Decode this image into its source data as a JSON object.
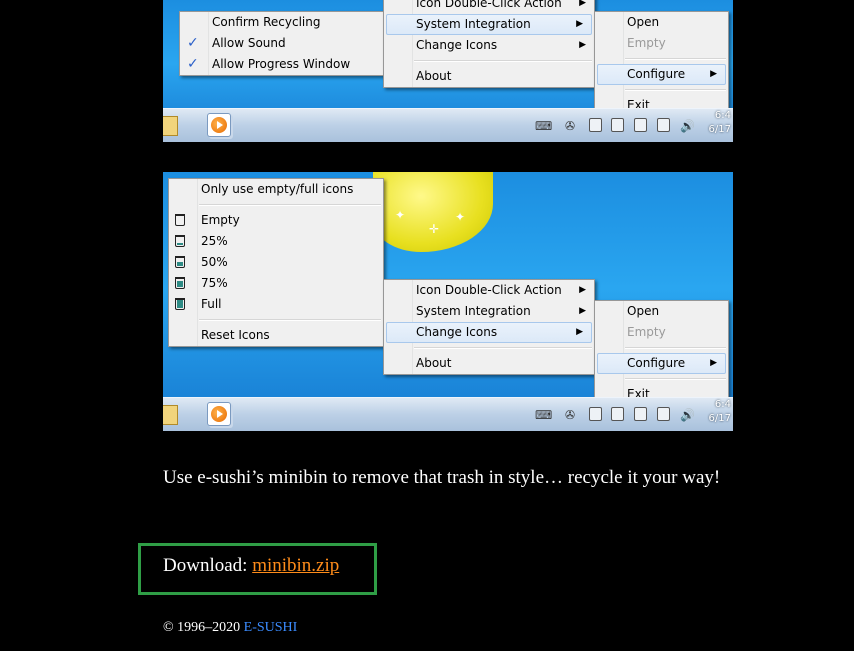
{
  "screenshot1": {
    "left_menu": [
      {
        "label": "Confirm Recycling",
        "checked": false
      },
      {
        "label": "Allow Sound",
        "checked": true
      },
      {
        "label": "Allow Progress Window",
        "checked": true
      }
    ],
    "main_menu": {
      "top_partial": "Icon Double-Click Action",
      "items": [
        "System Integration",
        "Change Icons"
      ],
      "about": "About"
    },
    "right_menu": {
      "open": "Open",
      "empty": "Empty",
      "configure": "Configure",
      "exit": "Exit"
    },
    "clock": {
      "time": "6:4",
      "date": "6/17"
    }
  },
  "screenshot2": {
    "icons_menu": {
      "only_empty_full": "Only use empty/full icons",
      "levels": [
        {
          "label": "Empty",
          "fill": 0
        },
        {
          "label": "25%",
          "fill": 0.25
        },
        {
          "label": "50%",
          "fill": 0.5
        },
        {
          "label": "75%",
          "fill": 0.75
        },
        {
          "label": "Full",
          "fill": 1
        }
      ],
      "reset": "Reset Icons"
    },
    "main_menu": {
      "items": [
        "Icon Double-Click Action",
        "System Integration",
        "Change Icons"
      ],
      "about": "About"
    },
    "right_menu": {
      "open": "Open",
      "empty": "Empty",
      "configure": "Configure",
      "exit": "Exit"
    },
    "clock": {
      "time": "6:4",
      "date": "6/17"
    }
  },
  "text": {
    "paragraph": "Use e-sushi’s minibin to remove that trash in style… recycle it your way!",
    "download_label": "Download: ",
    "download_link": "minibin.zip",
    "copyright": "© 1996–2020 ",
    "footer_link": "E-SUSHI"
  },
  "colors": {
    "link_orange": "#ff8c1a",
    "footer_link_blue": "#3b8cff",
    "highlight_border_green": "#2f9e46",
    "background": "#000000"
  }
}
